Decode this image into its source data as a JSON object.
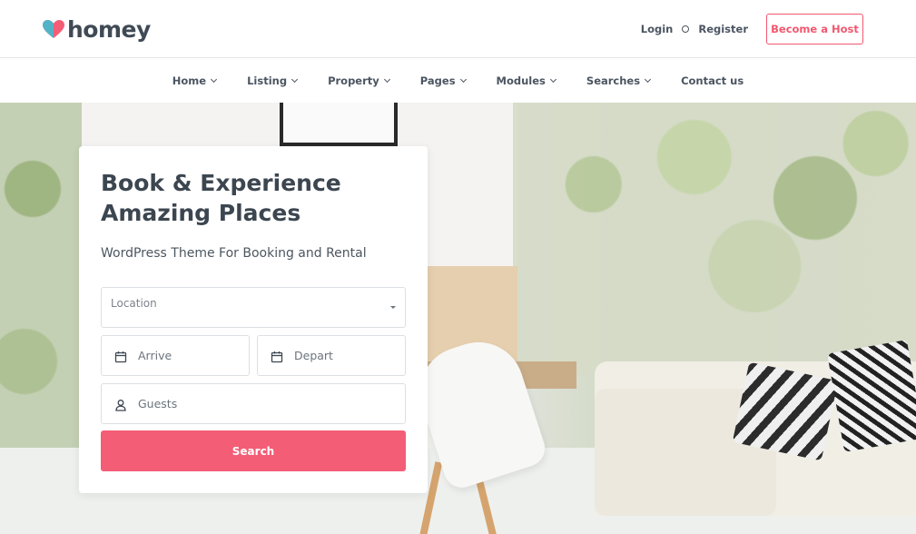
{
  "header": {
    "logo_text": "homey",
    "login_label": "Login",
    "register_label": "Register",
    "host_button_label": "Become a Host"
  },
  "nav": {
    "items": [
      {
        "label": "Home",
        "dropdown": true
      },
      {
        "label": "Listing",
        "dropdown": true
      },
      {
        "label": "Property",
        "dropdown": true
      },
      {
        "label": "Pages",
        "dropdown": true
      },
      {
        "label": "Modules",
        "dropdown": true
      },
      {
        "label": "Searches",
        "dropdown": true
      },
      {
        "label": "Contact us",
        "dropdown": false
      }
    ]
  },
  "hero": {
    "title": "Book & Experience Amazing Places",
    "subtitle": "WordPress Theme For Booking and Rental"
  },
  "search_form": {
    "location_placeholder": "Location",
    "arrive_placeholder": "Arrive",
    "depart_placeholder": "Depart",
    "guests_placeholder": "Guests",
    "search_label": "Search"
  },
  "colors": {
    "accent": "#f35d76",
    "text_dark": "#3c4650"
  },
  "icons": {
    "logo": "heart-logo-icon",
    "arrive": "calendar-icon",
    "depart": "calendar-icon",
    "guests": "user-icon",
    "location_toggle": "caret-down-icon",
    "nav_dropdown": "chevron-down-icon"
  }
}
